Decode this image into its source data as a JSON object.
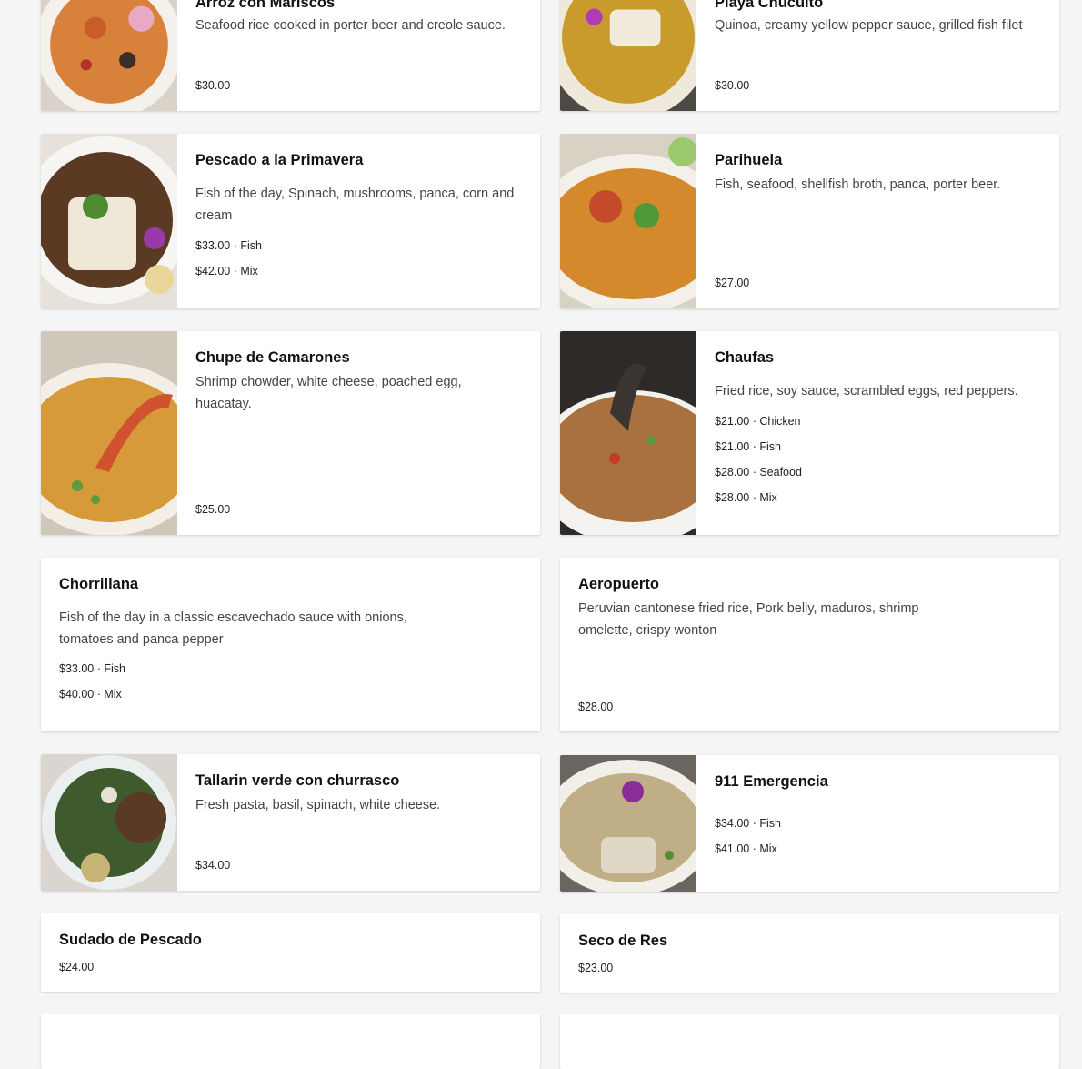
{
  "menu": {
    "items": [
      {
        "title": "Arroz con Mariscos",
        "image": "seafood-rice-photo",
        "desc": "Seafood rice cooked in porter beer and creole sauce.",
        "prices": [
          "$30.00"
        ]
      },
      {
        "title": "Playa Chucuito",
        "image": "quinoa-fish-photo",
        "desc": "Quinoa, creamy yellow pepper sauce, grilled fish filet",
        "prices": [
          "$30.00"
        ]
      },
      {
        "title": "Pescado a la Primavera",
        "image": "fish-spinach-photo",
        "desc": "Fish of the day, Spinach, mushrooms, panca, corn and cream",
        "prices": [
          "$33.00 · Fish",
          "$42.00 · Mix"
        ]
      },
      {
        "title": "Parihuela",
        "image": "seafood-broth-photo",
        "desc": "Fish, seafood, shellfish broth, panca, porter beer.",
        "prices": [
          "$27.00"
        ]
      },
      {
        "title": "Chupe de Camarones",
        "image": "shrimp-chowder-photo",
        "desc": "Shrimp chowder, white cheese, poached egg, huacatay.",
        "prices": [
          "$25.00"
        ]
      },
      {
        "title": "Chaufas",
        "image": "fried-rice-photo",
        "desc": "Fried rice, soy sauce, scrambled eggs, red peppers.",
        "prices": [
          "$21.00 · Chicken",
          "$21.00 · Fish",
          "$28.00 · Seafood",
          "$28.00 · Mix"
        ]
      },
      {
        "title": "Chorrillana",
        "desc": "Fish of the day in a classic escavechado sauce with onions, tomatoes and panca pepper",
        "prices": [
          "$33.00 · Fish",
          "$40.00 · Mix"
        ]
      },
      {
        "title": "Aeropuerto",
        "desc": "Peruvian cantonese fried rice, Pork belly, maduros, shrimp omelette, crispy wonton",
        "prices": [
          "$28.00"
        ]
      },
      {
        "title": "Tallarin verde con churrasco",
        "image": "green-pasta-steak-photo",
        "desc": "Fresh pasta, basil, spinach, white cheese.",
        "prices": [
          "$34.00"
        ]
      },
      {
        "title": "911 Emergencia",
        "image": "fish-cream-sauce-photo",
        "desc": "",
        "prices": [
          "$34.00 · Fish",
          "$41.00 · Mix"
        ]
      },
      {
        "title": "Sudado de Pescado",
        "prices": [
          "$24.00"
        ]
      },
      {
        "title": "Seco de Res",
        "prices": [
          "$23.00"
        ]
      }
    ]
  },
  "colors": {
    "page_background": "#f5f5f5",
    "card_background": "#ffffff",
    "title_text": "#111111",
    "description_text": "#444444"
  }
}
